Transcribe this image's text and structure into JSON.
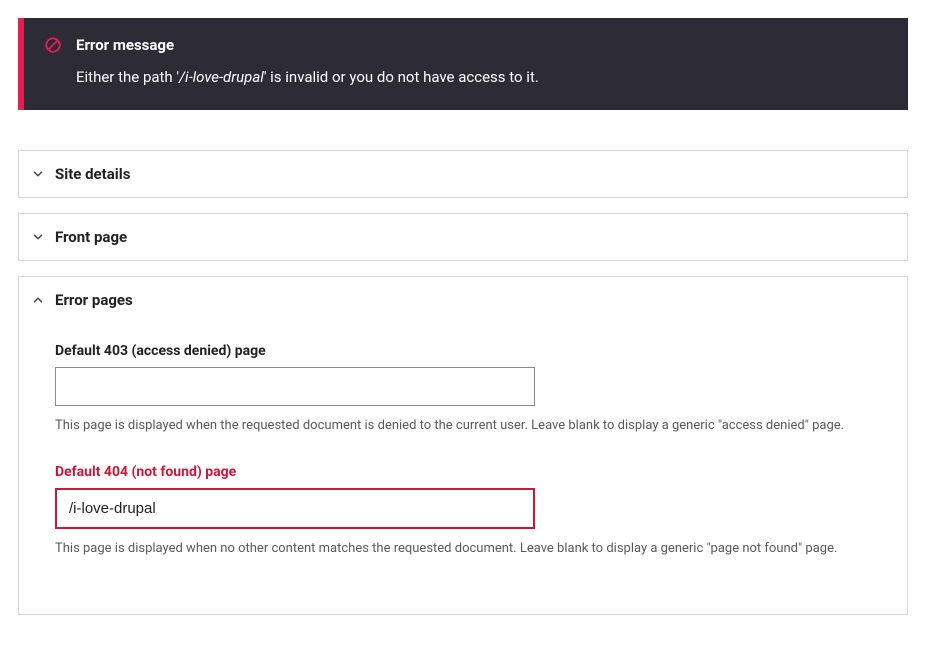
{
  "error": {
    "title": "Error message",
    "prefix": "Either the path '",
    "path": "/i-love-drupal",
    "suffix": "' is invalid or you do not have access to it."
  },
  "accordions": {
    "site_details": {
      "title": "Site details"
    },
    "front_page": {
      "title": "Front page"
    },
    "error_pages": {
      "title": "Error pages"
    }
  },
  "fields": {
    "page_403": {
      "label": "Default 403 (access denied) page",
      "value": "",
      "help": "This page is displayed when the requested document is denied to the current user. Leave blank to display a generic \"access denied\" page."
    },
    "page_404": {
      "label": "Default 404 (not found) page",
      "value": "/i-love-drupal",
      "help": "This page is displayed when no other content matches the requested document. Leave blank to display a generic \"page not found\" page."
    }
  }
}
